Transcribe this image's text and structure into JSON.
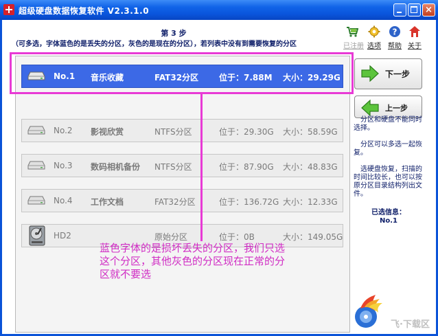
{
  "window": {
    "title": "超级硬盘数据恢复软件 V2.3.1.0",
    "close_glyph": "×"
  },
  "header": {
    "step_title": "第 3 步",
    "instruction": "（可多选，字体蓝色的是丢失的分区，灰色的是现在的分区），若列表中没有到需要恢复的分区"
  },
  "toolbar": {
    "items": [
      {
        "label": "已注册",
        "icon": "cart-icon"
      },
      {
        "label": "选项",
        "icon": "gear-icon"
      },
      {
        "label": "帮助",
        "icon": "help-icon"
      },
      {
        "label": "关于",
        "icon": "home-icon"
      }
    ]
  },
  "partitions": [
    {
      "no": "No.1",
      "name": "音乐收藏",
      "fs": "FAT32分区",
      "pos": "位于：7.88M",
      "size": "大小：29.29G"
    },
    {
      "no": "No.2",
      "name": "影视欣赏",
      "fs": "NTFS分区",
      "pos": "位于：29.30G",
      "size": "大小：58.59G"
    },
    {
      "no": "No.3",
      "name": "数码相机备份",
      "fs": "NTFS分区",
      "pos": "位于：87.90G",
      "size": "大小：48.83G"
    },
    {
      "no": "No.4",
      "name": "工作文档",
      "fs": "FAT32分区",
      "pos": "位于：136.72G",
      "size": "大小：12.33G"
    },
    {
      "no": "HD2",
      "name": "",
      "fs": "原始分区",
      "pos": "位于：0B",
      "size": "大小：149.05G"
    }
  ],
  "buttons": {
    "next": "下一步",
    "prev": "上一步"
  },
  "notes": {
    "n1": "分区和硬盘不能同时选择。",
    "n2": "分区可以多选一起恢复。",
    "n3": "选硬盘恢复，扫描的时间比较长，也可以按原分区目录结构列出文件。"
  },
  "selection": {
    "label": "已选信息：",
    "value": "No.1"
  },
  "annotation": "蓝色字体的是损坏丢失的分区，我们只选这个分区，其他灰色的分区现在正常的分区就不要选",
  "watermark": "飞·下载区",
  "colors": {
    "accent": "#3c69e6",
    "highlight": "#e83ad5",
    "titlebar": "#0a55dc"
  }
}
